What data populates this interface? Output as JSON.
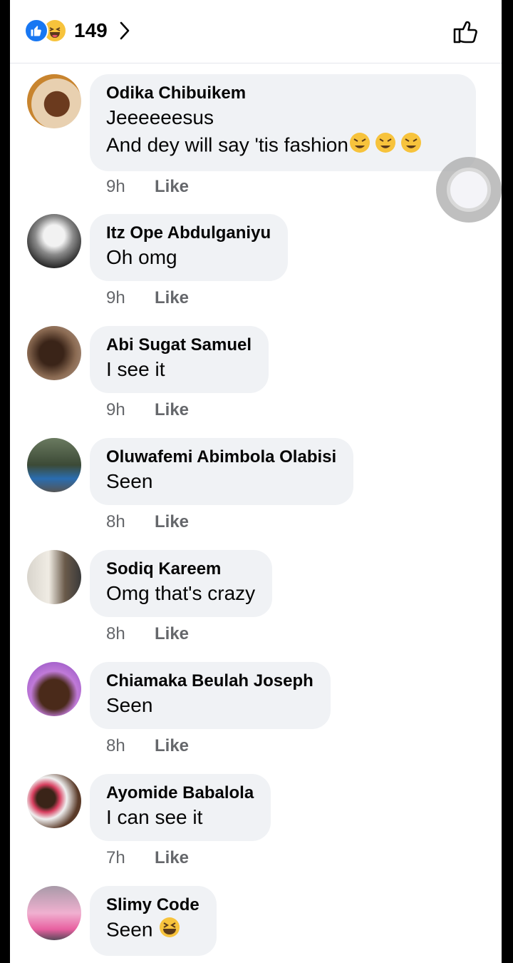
{
  "header": {
    "reaction_count": "149",
    "icons": [
      "like-reaction-icon",
      "haha-reaction-icon",
      "chevron-right-icon",
      "thumbs-up-icon"
    ]
  },
  "colors": {
    "accent": "#1877f2",
    "bubble": "#f0f2f5",
    "meta": "#65676b"
  },
  "comments": [
    {
      "name": "Odika Chibuikem",
      "lines": [
        "Jeeeeeesus",
        "And dey will say 'tis fashion"
      ],
      "emoji": "rolling-laughing-icon x3",
      "time": "9h",
      "like": "Like"
    },
    {
      "name": "Itz Ope Abdulganiyu",
      "lines": [
        "Oh omg"
      ],
      "time": "9h",
      "like": "Like"
    },
    {
      "name": "Abi Sugat Samuel",
      "lines": [
        "I see it"
      ],
      "time": "9h",
      "like": "Like"
    },
    {
      "name": "Oluwafemi Abimbola Olabisi",
      "lines": [
        "Seen"
      ],
      "time": "8h",
      "like": "Like"
    },
    {
      "name": "Sodiq Kareem",
      "lines": [
        "Omg that's crazy"
      ],
      "time": "8h",
      "like": "Like"
    },
    {
      "name": "Chiamaka Beulah Joseph",
      "lines": [
        "Seen"
      ],
      "time": "8h",
      "like": "Like"
    },
    {
      "name": "Ayomide Babalola",
      "lines": [
        "I can see it"
      ],
      "time": "7h",
      "like": "Like"
    },
    {
      "name": "Slimy Code",
      "lines": [
        "Seen"
      ],
      "emoji": "grinning-squinting-icon",
      "time": "",
      "like": ""
    }
  ]
}
